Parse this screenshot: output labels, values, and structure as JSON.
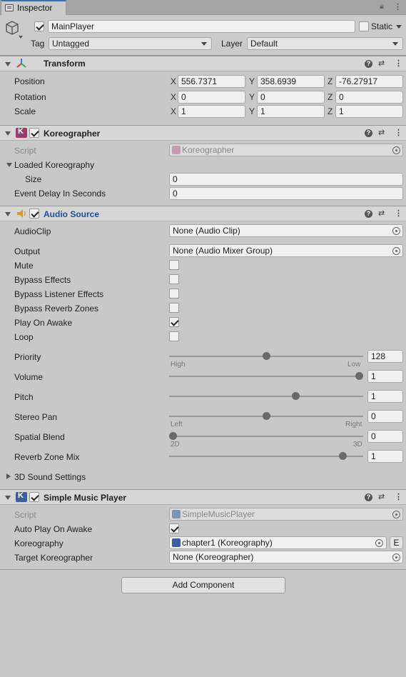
{
  "tab": {
    "label": "Inspector"
  },
  "header": {
    "object_name": "MainPlayer",
    "static_label": "Static",
    "tag_label": "Tag",
    "tag_value": "Untagged",
    "layer_label": "Layer",
    "layer_value": "Default"
  },
  "transform": {
    "title": "Transform",
    "position": {
      "label": "Position",
      "x": "556.7371",
      "y": "358.6939",
      "z": "-76.27917"
    },
    "rotation": {
      "label": "Rotation",
      "x": "0",
      "y": "0",
      "z": "0"
    },
    "scale": {
      "label": "Scale",
      "x": "1",
      "y": "1",
      "z": "1"
    },
    "axis_x": "X",
    "axis_y": "Y",
    "axis_z": "Z"
  },
  "koreographer": {
    "title": "Koreographer",
    "script_label": "Script",
    "script_value": "Koreographer",
    "loaded_label": "Loaded Koreography",
    "size_label": "Size",
    "size_value": "0",
    "delay_label": "Event Delay In Seconds",
    "delay_value": "0"
  },
  "audio": {
    "title": "Audio Source",
    "clip_label": "AudioClip",
    "clip_value": "None (Audio Clip)",
    "output_label": "Output",
    "output_value": "None (Audio Mixer Group)",
    "mute_label": "Mute",
    "bypass_effects_label": "Bypass Effects",
    "bypass_listener_label": "Bypass Listener Effects",
    "bypass_reverb_label": "Bypass Reverb Zones",
    "play_on_awake_label": "Play On Awake",
    "loop_label": "Loop",
    "priority_label": "Priority",
    "priority_value": "128",
    "priority_low_text": "High",
    "priority_high_text": "Low",
    "volume_label": "Volume",
    "volume_value": "1",
    "pitch_label": "Pitch",
    "pitch_value": "1",
    "stereo_label": "Stereo Pan",
    "stereo_value": "0",
    "stereo_left": "Left",
    "stereo_right": "Right",
    "spatial_label": "Spatial Blend",
    "spatial_value": "0",
    "spatial_left": "2D",
    "spatial_right": "3D",
    "reverb_label": "Reverb Zone Mix",
    "reverb_value": "1",
    "sound3d_label": "3D Sound Settings",
    "priority_fraction": 0.5,
    "volume_fraction": 1.0,
    "pitch_fraction": 0.66,
    "stereo_fraction": 0.5,
    "spatial_fraction": 0.0,
    "reverb_fraction": 0.91
  },
  "smp": {
    "title": "Simple Music Player",
    "script_label": "Script",
    "script_value": "SimpleMusicPlayer",
    "autoplay_label": "Auto Play On Awake",
    "koreo_label": "Koreography",
    "koreo_value": "chapter1 (Koreography)",
    "koreo_edit": "E",
    "target_label": "Target Koreographer",
    "target_value": "None (Koreographer)"
  },
  "add_component": "Add Component"
}
